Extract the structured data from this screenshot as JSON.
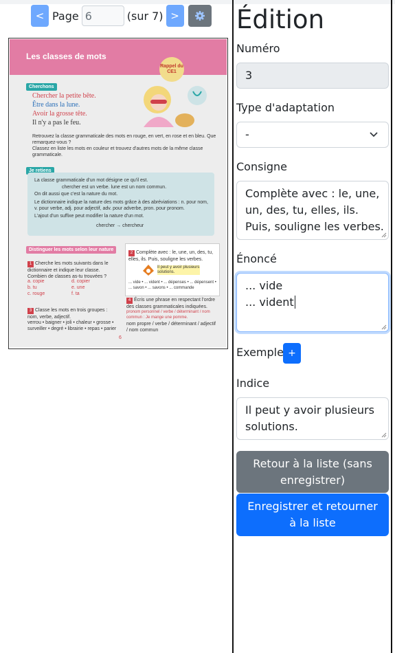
{
  "pager": {
    "prev_label": "<",
    "page_label": "Page",
    "page_value": "6",
    "total_label": "(sur 7)",
    "next_label": ">",
    "settings_icon": "gear-icon"
  },
  "book_page": {
    "title": "Les classes de mots",
    "badge": "Rappel du CE1",
    "cherchons": "Cherchons",
    "lines": [
      "Chercher la petite bête.",
      "Être dans la lune.",
      "Avoir la grosse tête.",
      "Il n'y a pas le feu."
    ],
    "instructions": [
      "Retrouvez la classe grammaticale des mots en rouge, en vert, en rose et en bleu. Que remarquez-vous ?",
      "Classez en liste les mots en couleur et trouvez d'autres mots de la même classe grammaticale."
    ],
    "je_retiens": "Je retiens",
    "retiens_lines": [
      "La classe grammaticale d'un mot désigne ce qu'il est.",
      "chercher est un verbe.   lune est un nom commun.",
      "On dit aussi que c'est la nature du mot.",
      "Le dictionnaire indique la nature des mots grâce à des abréviations : n. pour nom, v. pour verbe, adj. pour adjectif, adv. pour adverbe, pron. pour pronom.",
      "L'ajout d'un suffixe peut modifier la nature d'un mot.",
      "chercher → chercheur"
    ],
    "distinguer": "Distinguer les mots selon leur nature",
    "exo1": "Cherche les mots suivants dans le dictionnaire et indique leur classe. Combien de classes as-tu trouvées ?",
    "exo1_words": [
      "a. copie",
      "b. tu",
      "c. rouge",
      "d. copier",
      "e. une",
      "f. ta"
    ],
    "exo2": "Complète avec : le, une, un, des, tu, elles, ils. Puis, souligne les verbes.",
    "exo2_hint": "Il peut y avoir plusieurs solutions.",
    "exo2_words": "... vide • ... vident • ... dépenses • ... dépensent • ... savon • ... savons • ... commande",
    "exo3": "Classe les mots en trois groupes : nom, verbe, adjectif.",
    "exo3_words": "verrou • baigner • joli • chaleur • grosse • surveiller • degré • librairie • repas • parier",
    "exo4": "Écris une phrase en respectant l'ordre des classes grammaticales indiquées.",
    "exo4_example": "pronom personnel / verbe / déterminant / nom commun : Je mange une pomme.",
    "exo4_words": "nom propre / verbe / déterminant / adjectif / nom commun",
    "page_number": "6"
  },
  "form": {
    "heading": "Édition",
    "numero_label": "Numéro",
    "numero_value": "3",
    "type_label": "Type d'adaptation",
    "type_value": "-",
    "consigne_label": "Consigne",
    "consigne_lines": [
      "Complète avec : le, une,",
      "un, des, tu, elles, ils.",
      "Puis, souligne les verbes."
    ],
    "enonce_label": "Énoncé",
    "enonce_lines": [
      "... vide",
      "... vident"
    ],
    "exemple_label": "Exemple",
    "exemple_add": "+",
    "indice_label": "Indice",
    "indice_lines": [
      "Il peut y avoir plusieurs",
      "solutions."
    ],
    "back_button": "Retour à la liste (sans enregistrer)",
    "save_button": "Enregistrer et retourner à la liste"
  }
}
